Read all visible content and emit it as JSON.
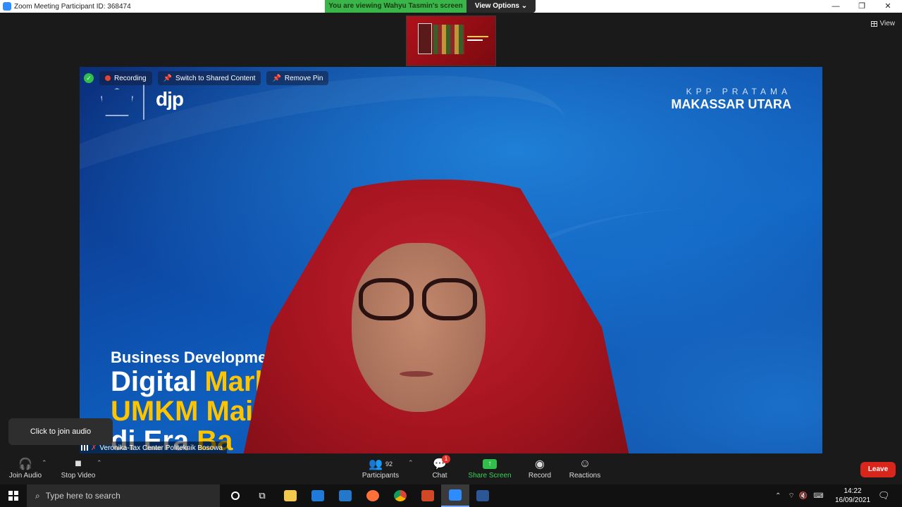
{
  "window": {
    "title": "Zoom Meeting Participant ID: 368474",
    "controls": {
      "minimize": "—",
      "restore": "❐",
      "close": "✕"
    }
  },
  "share_banner": {
    "text": "You are viewing Wahyu Tasmin's screen",
    "view_options": "View Options ⌄"
  },
  "view_button": {
    "label": "View"
  },
  "video_overlay": {
    "recording": "Recording",
    "switch": "Switch to Shared Content",
    "remove_pin": "Remove Pin"
  },
  "slide": {
    "logo_text": "djp",
    "office_line1": "KPP PRATAMA",
    "office_line2": "MAKASSAR UTARA",
    "line1": "Business Developmen",
    "line2_white": "Digital ",
    "line2_yellow": "Mark",
    "line3": "UMKM Mai",
    "line4_white": "di Era ",
    "line4_yellow": "Ba"
  },
  "participant_name": "Veronika-Tax Center Politeknik Bosowa",
  "tooltip": {
    "text": "Click to join audio"
  },
  "toolbar": {
    "join_audio": "Join Audio",
    "stop_video": "Stop Video",
    "participants": "Participants",
    "participants_count": "92",
    "chat": "Chat",
    "chat_badge": "1",
    "share_screen": "Share Screen",
    "record": "Record",
    "reactions": "Reactions",
    "leave": "Leave"
  },
  "taskbar": {
    "search_placeholder": "Type here to search",
    "time": "14:22",
    "date": "16/09/2021",
    "apps": [
      "task-view",
      "file-explorer",
      "mail",
      "vscode",
      "firefox",
      "chrome",
      "powerpoint",
      "zoom",
      "word"
    ]
  },
  "colors": {
    "share_green": "#39b54a",
    "leave_red": "#d9261c",
    "slide_yellow": "#ffc400",
    "slide_blue": "#0e5fbf"
  }
}
